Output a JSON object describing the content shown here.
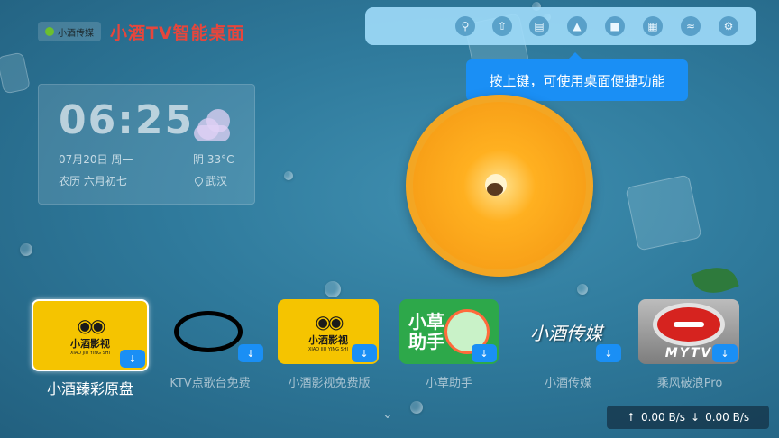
{
  "header": {
    "logo_text": "小酒传媒",
    "title": "小酒TV智能桌面"
  },
  "toolbar": {
    "buttons": [
      {
        "icon": "search-icon"
      },
      {
        "icon": "rocket-icon"
      },
      {
        "icon": "folder-icon"
      },
      {
        "icon": "image-icon"
      },
      {
        "icon": "shirt-icon"
      },
      {
        "icon": "apps-grid-icon"
      },
      {
        "icon": "wifi-icon"
      },
      {
        "icon": "gear-icon"
      }
    ]
  },
  "tooltip": {
    "text": "按上键，可使用桌面便捷功能"
  },
  "clock": {
    "time": "06:25",
    "date": "07月20日  周一",
    "lunar": "农历  六月初七",
    "weather": "阴 33°C",
    "city": "武汉"
  },
  "apps": [
    {
      "label": "小酒臻彩原盘",
      "tile_name": "小酒影视",
      "tile_sub": "XIAO JIU YING SHI",
      "selected": true
    },
    {
      "label": "KTV点歌台免费",
      "selected": false
    },
    {
      "label": "小酒影视免费版",
      "tile_name": "小酒影视",
      "tile_sub": "XIAO JIU YING SHI",
      "selected": false
    },
    {
      "label": "小草助手",
      "tile_text": "小草\n助手",
      "selected": false
    },
    {
      "label": "小酒传媒",
      "tile_text": "小酒传媒",
      "selected": false
    },
    {
      "label": "乘风破浪Pro",
      "tile_text": "MYTV",
      "selected": false
    }
  ],
  "network": {
    "upload": "0.00 B/s",
    "download": "0.00 B/s"
  },
  "colors": {
    "accent": "#1a8ff5",
    "brand_red": "#e6463c",
    "tile_yellow": "#f5c400",
    "tile_green": "#2da84a"
  }
}
